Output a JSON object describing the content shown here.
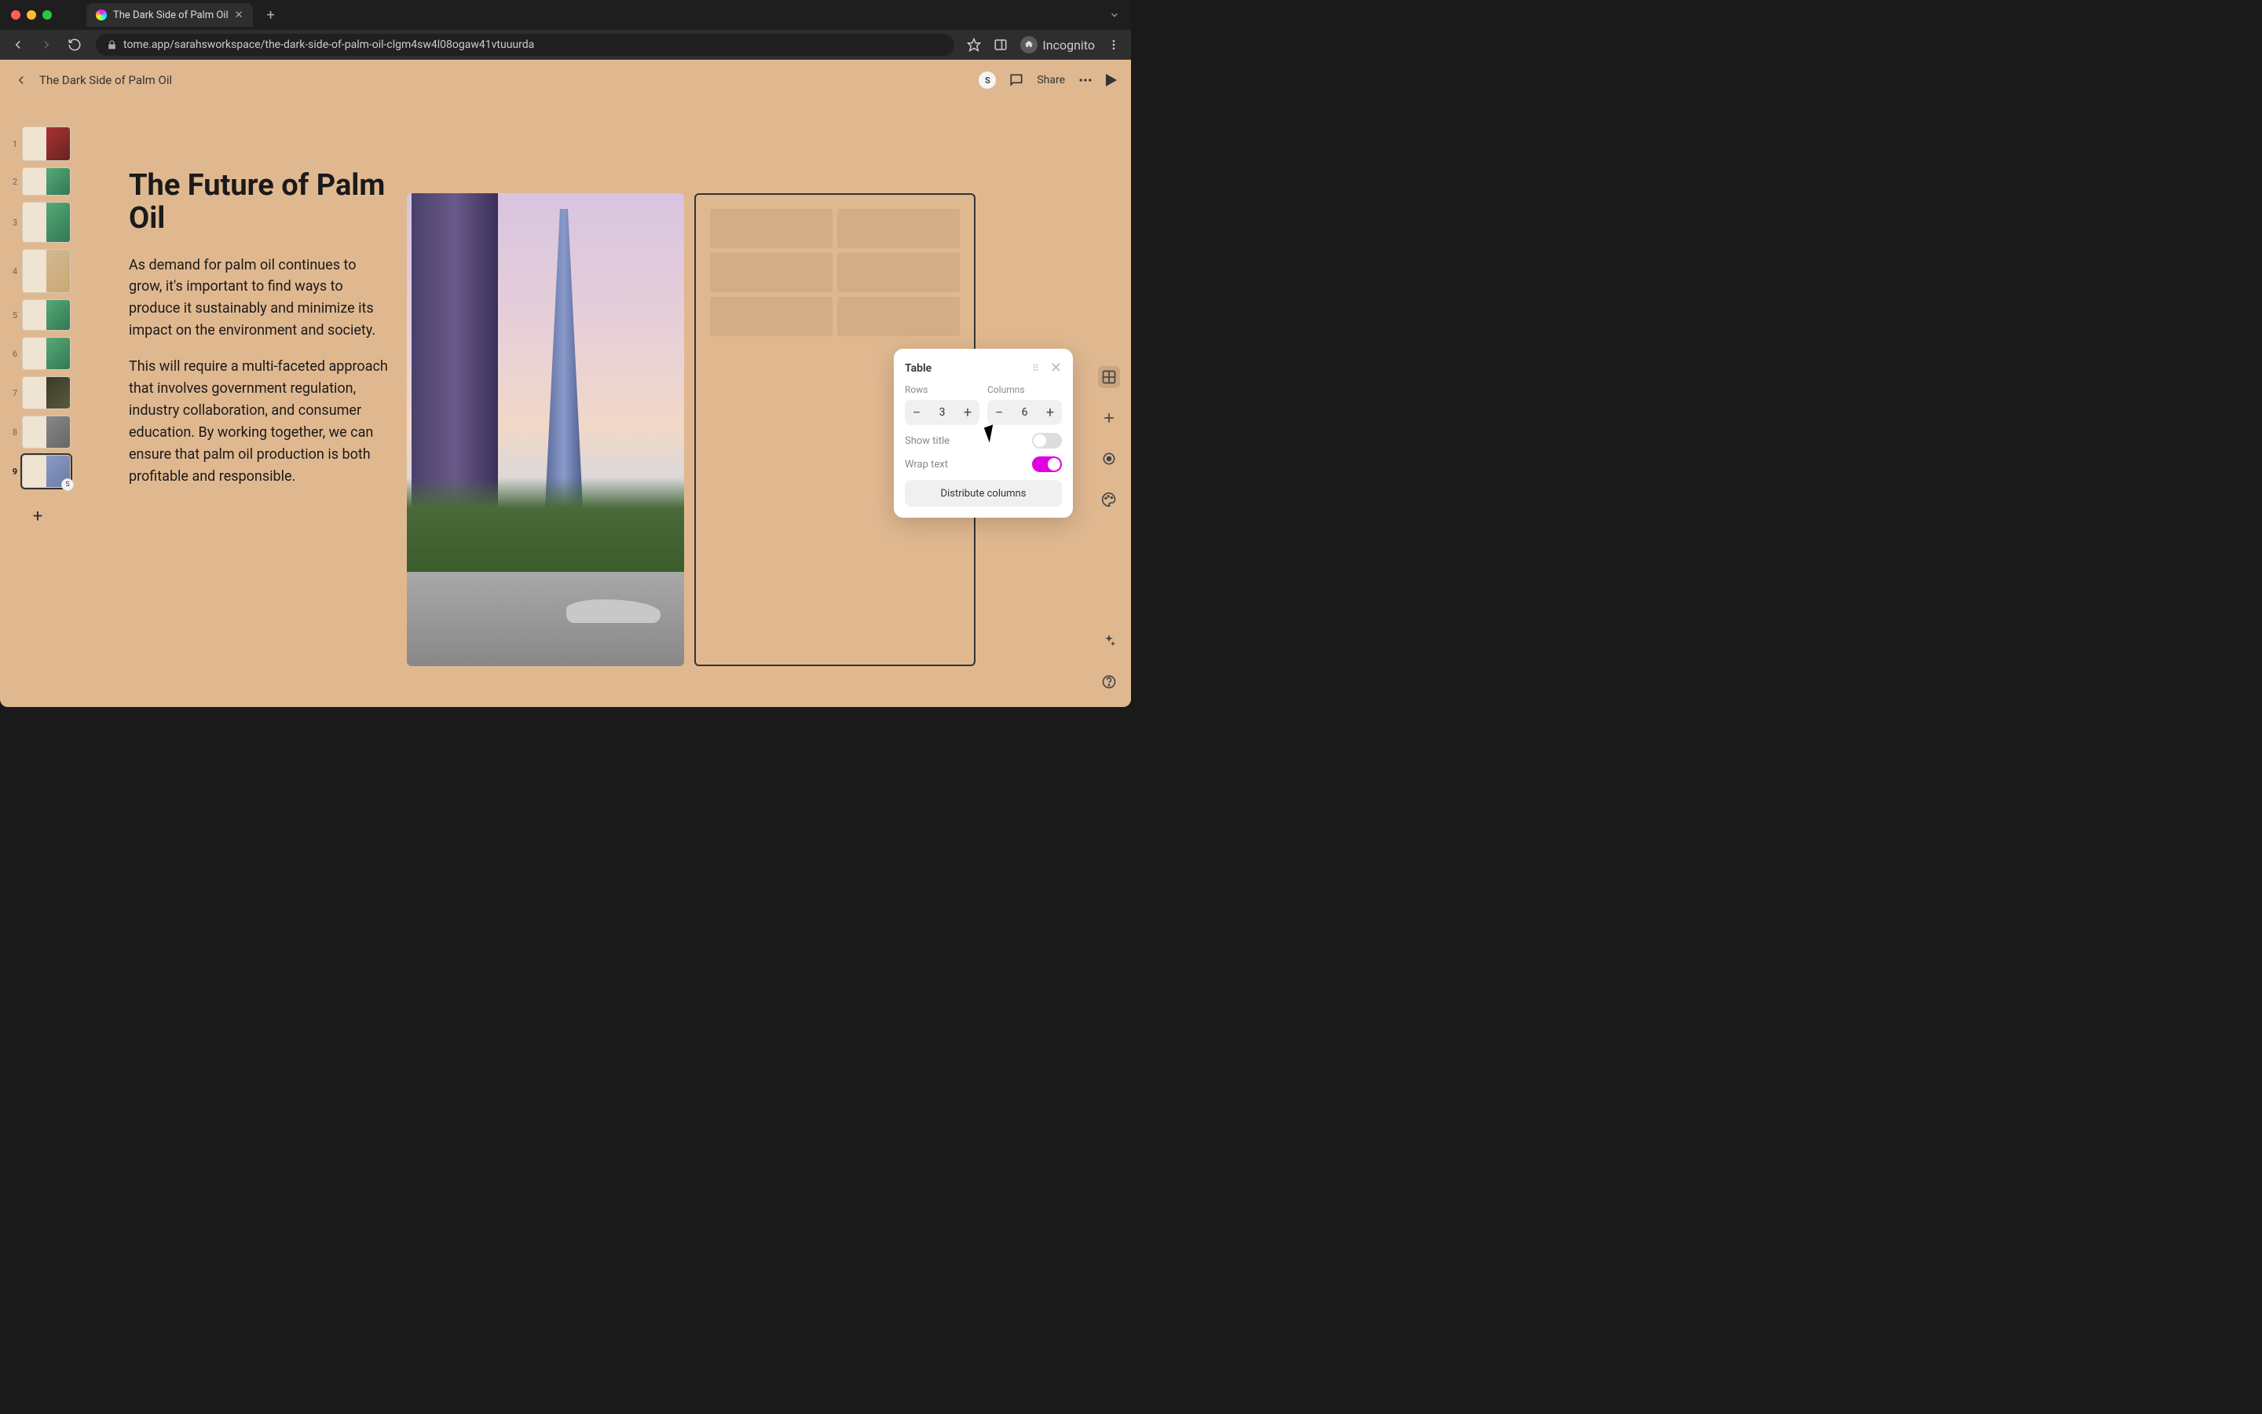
{
  "browser": {
    "tab_title": "The Dark Side of Palm Oil",
    "url": "tome.app/sarahsworkspace/the-dark-side-of-palm-oil-clgm4sw4l08ogaw41vtuuurda",
    "incognito_label": "Incognito"
  },
  "app": {
    "doc_title": "The Dark Side of Palm Oil",
    "share_label": "Share",
    "avatar_initial": "S"
  },
  "thumbnails": {
    "numbers": [
      "1",
      "2",
      "3",
      "4",
      "5",
      "6",
      "7",
      "8",
      "9"
    ],
    "active_index": 8
  },
  "slide": {
    "title": "The Future of Palm Oil",
    "body1": "As demand for palm oil continues to grow, it's important to find ways to produce it sustainably and minimize its impact on the environment and society.",
    "body2": "This will require a multi-faceted approach that involves government regulation, industry collaboration, and consumer education. By working together, we can ensure that palm oil production is both profitable and responsible."
  },
  "popover": {
    "title": "Table",
    "rows_label": "Rows",
    "rows_value": "3",
    "cols_label": "Columns",
    "cols_value": "6",
    "show_title_label": "Show title",
    "wrap_text_label": "Wrap text",
    "distribute_label": "Distribute columns"
  }
}
